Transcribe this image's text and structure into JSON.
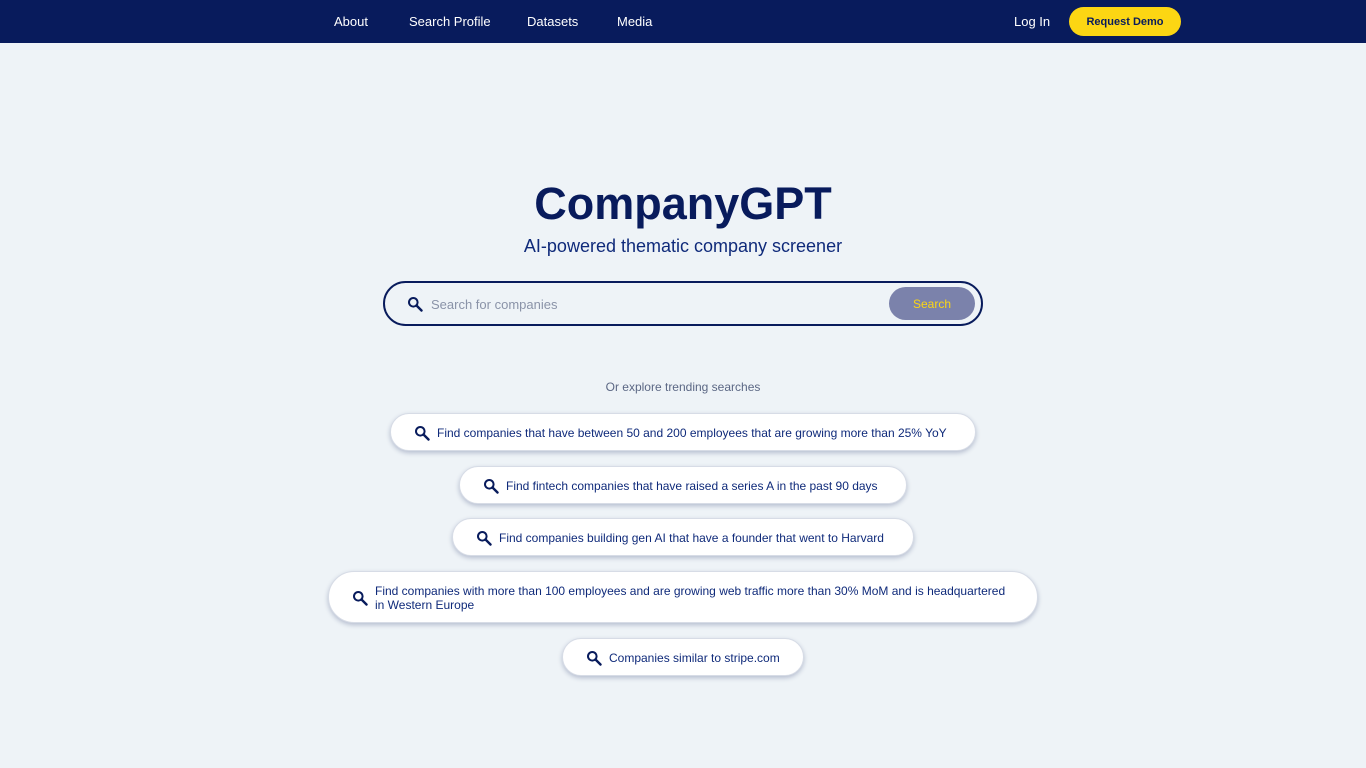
{
  "nav": {
    "links": [
      "About",
      "Search Profile",
      "Datasets",
      "Media"
    ],
    "login": "Log In",
    "demo": "Request Demo"
  },
  "hero": {
    "title": "CompanyGPT",
    "subtitle": "AI-powered thematic company screener"
  },
  "search": {
    "placeholder": "Search for companies",
    "button": "Search",
    "icon": "search-icon"
  },
  "trending": {
    "label": "Or explore trending searches",
    "items": [
      "Find companies that have between 50 and 200 employees that are growing more than 25% YoY",
      "Find fintech companies that have raised a series A in the past 90 days",
      "Find companies building gen AI that have a founder that went to Harvard",
      "Find companies with more than 100 employees and are growing web traffic more than 30% MoM and is headquartered in Western Europe",
      "Companies similar to stripe.com"
    ]
  },
  "colors": {
    "navbar": "#081b5c",
    "accent": "#fcd613",
    "background": "#eef3f7",
    "search_button": "#7b82ab"
  }
}
